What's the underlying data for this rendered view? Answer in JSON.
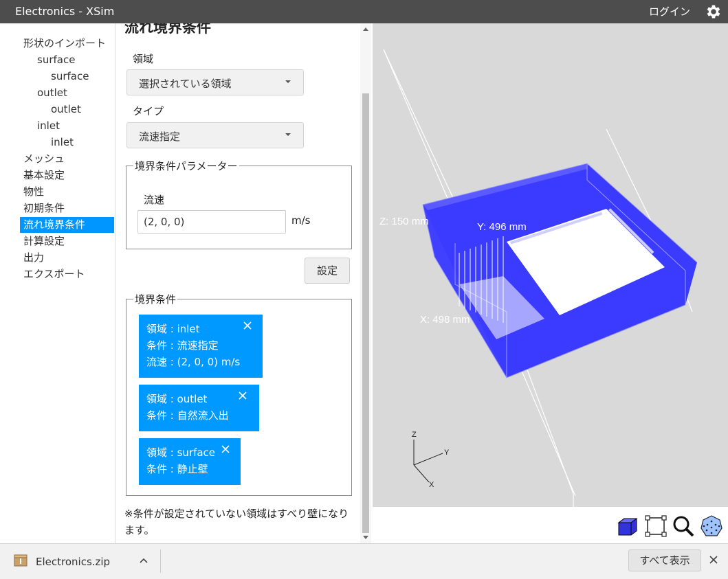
{
  "window": {
    "title": "Electronics - XSim",
    "login_label": "ログイン",
    "settings_icon": "gear-icon"
  },
  "nav": {
    "items": [
      {
        "label": "形状のインポート",
        "level": 0,
        "active": false
      },
      {
        "label": "surface",
        "level": 1,
        "active": false
      },
      {
        "label": "surface",
        "level": 2,
        "active": false
      },
      {
        "label": "outlet",
        "level": 1,
        "active": false
      },
      {
        "label": "outlet",
        "level": 2,
        "active": false
      },
      {
        "label": "inlet",
        "level": 1,
        "active": false
      },
      {
        "label": "inlet",
        "level": 2,
        "active": false
      },
      {
        "label": "メッシュ",
        "level": 0,
        "active": false
      },
      {
        "label": "基本設定",
        "level": 0,
        "active": false
      },
      {
        "label": "物性",
        "level": 0,
        "active": false
      },
      {
        "label": "初期条件",
        "level": 0,
        "active": false
      },
      {
        "label": "流れ境界条件",
        "level": 0,
        "active": true
      },
      {
        "label": "計算設定",
        "level": 0,
        "active": false
      },
      {
        "label": "出力",
        "level": 0,
        "active": false
      },
      {
        "label": "エクスポート",
        "level": 0,
        "active": false
      }
    ],
    "active_color": "#0096ff"
  },
  "form": {
    "heading": "流れ境界条件",
    "region_label": "領域",
    "region_value": "選択されている領域",
    "type_label": "タイプ",
    "type_value": "流速指定",
    "params_legend": "境界条件パラメーター",
    "velocity_label": "流速",
    "velocity_value": "(2, 0, 0)",
    "velocity_unit": "m/s",
    "set_button": "設定",
    "conditions_legend": "境界条件",
    "conditions": [
      {
        "lines": [
          "領域 : inlet",
          "条件 : 流速指定",
          "流速 : (2, 0, 0) m/s"
        ]
      },
      {
        "lines": [
          "領域 : outlet",
          "条件 : 自然流入出"
        ]
      },
      {
        "lines": [
          "領域 : surface",
          "条件 : 静止壁"
        ]
      }
    ],
    "condition_color": "#0099ff",
    "note": "※条件が設定されていない領域はすべり壁になります。"
  },
  "viewport": {
    "background": "#d9d9d9",
    "model_color": "#3333ff",
    "dimension_labels": {
      "x": "X: 498 mm",
      "y": "Y: 496 mm",
      "z": "Z: 150 mm"
    },
    "axis_labels": {
      "x": "X",
      "y": "Y",
      "z": "Z"
    },
    "toolbar_icons": [
      "cube-view-icon",
      "fit-frame-icon",
      "zoom-icon",
      "mesh-sphere-icon"
    ]
  },
  "download_bar": {
    "file_name": "Electronics.zip",
    "show_all_label": "すべて表示"
  }
}
